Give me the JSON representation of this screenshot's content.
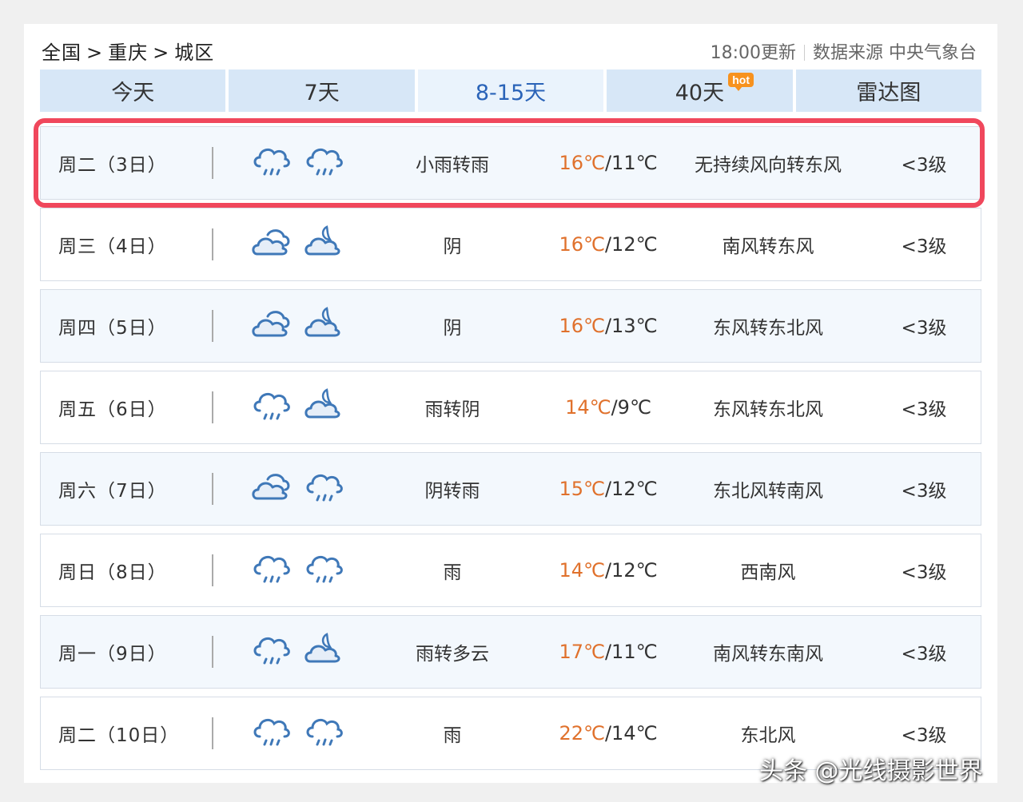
{
  "breadcrumb": {
    "country": "全国",
    "city": "重庆",
    "district": "城区",
    "separator": ">"
  },
  "source": {
    "update_time": "18:00更新",
    "label": "数据来源 中央气象台"
  },
  "tabs": [
    {
      "label": "今天",
      "active": false
    },
    {
      "label": "7天",
      "active": false
    },
    {
      "label": "8-15天",
      "active": true
    },
    {
      "label": "40天",
      "active": false,
      "badge": "hot"
    },
    {
      "label": "雷达图",
      "active": false
    }
  ],
  "forecast": [
    {
      "date": "周二（3日）",
      "day_icon": "rain-cloud-icon",
      "night_icon": "rain-cloud-icon",
      "desc": "小雨转雨",
      "high": "16℃",
      "low": "11℃",
      "wind": "无持续风向转东风",
      "level": "<3级",
      "highlighted": true
    },
    {
      "date": "周三（4日）",
      "day_icon": "overcast-icon",
      "night_icon": "cloud-moon-icon",
      "desc": "阴",
      "high": "16℃",
      "low": "12℃",
      "wind": "南风转东风",
      "level": "<3级"
    },
    {
      "date": "周四（5日）",
      "day_icon": "overcast-icon",
      "night_icon": "cloud-moon-icon",
      "desc": "阴",
      "high": "16℃",
      "low": "13℃",
      "wind": "东风转东北风",
      "level": "<3级"
    },
    {
      "date": "周五（6日）",
      "day_icon": "rain-cloud-icon",
      "night_icon": "cloud-moon-icon",
      "desc": "雨转阴",
      "high": "14℃",
      "low": "9℃",
      "wind": "东风转东北风",
      "level": "<3级"
    },
    {
      "date": "周六（7日）",
      "day_icon": "overcast-icon",
      "night_icon": "rain-cloud-icon",
      "desc": "阴转雨",
      "high": "15℃",
      "low": "12℃",
      "wind": "东北风转南风",
      "level": "<3级"
    },
    {
      "date": "周日（8日）",
      "day_icon": "rain-cloud-icon",
      "night_icon": "rain-cloud-icon",
      "desc": "雨",
      "high": "14℃",
      "low": "12℃",
      "wind": "西南风",
      "level": "<3级"
    },
    {
      "date": "周一（9日）",
      "day_icon": "rain-cloud-icon",
      "night_icon": "cloud-moon-icon",
      "desc": "雨转多云",
      "high": "17℃",
      "low": "11℃",
      "wind": "南风转东南风",
      "level": "<3级"
    },
    {
      "date": "周二（10日）",
      "day_icon": "rain-cloud-icon",
      "night_icon": "rain-cloud-icon",
      "desc": "雨",
      "high": "22℃",
      "low": "14℃",
      "wind": "东北风",
      "level": "<3级"
    }
  ],
  "watermark": "头条 @光线摄影世界",
  "colors": {
    "tab_bg": "#d7e7f7",
    "tab_active_text": "#2a63b8",
    "high_temp": "#e0712c",
    "highlight_border": "#f0475c",
    "icon_stroke": "#3f78b8"
  }
}
